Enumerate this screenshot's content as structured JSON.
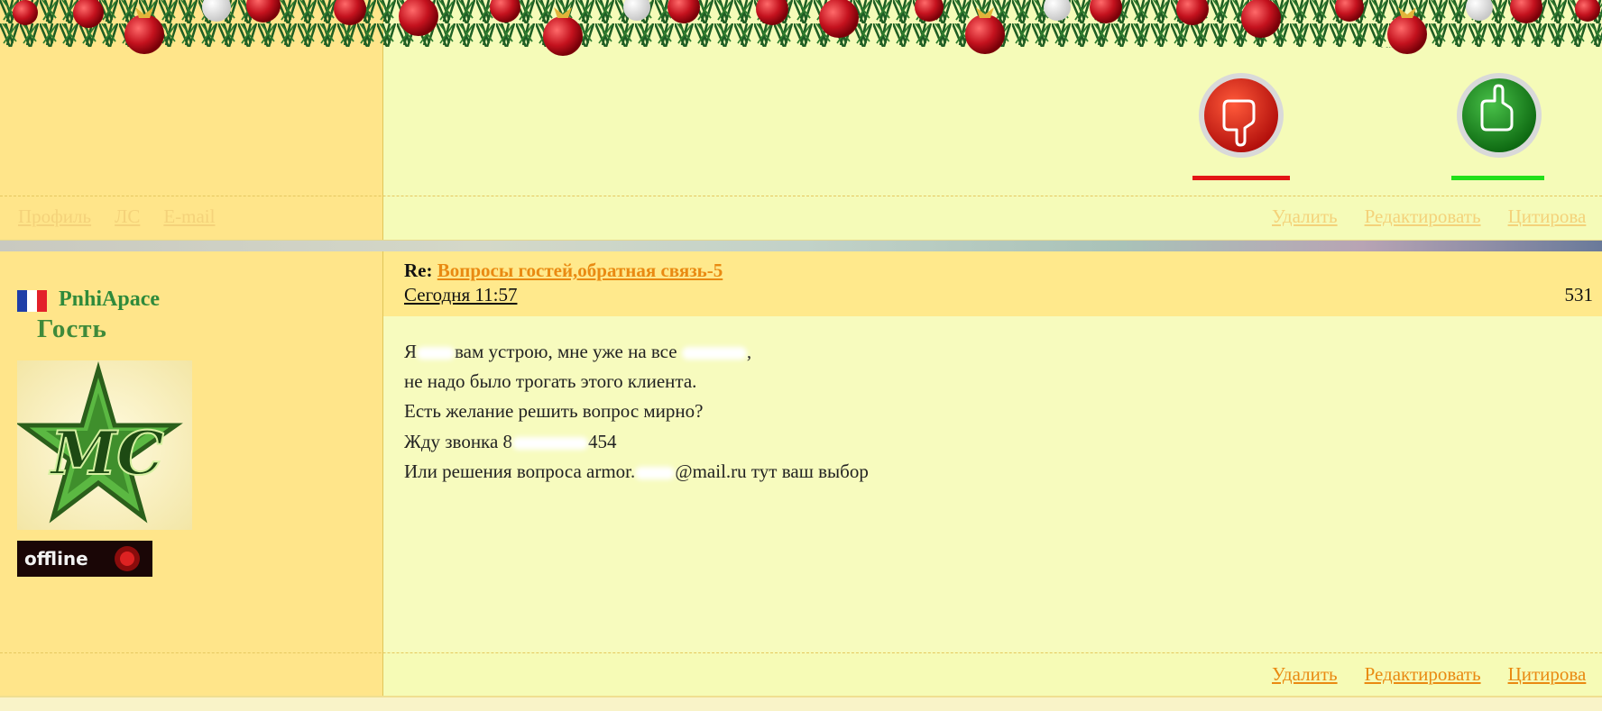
{
  "top_post": {
    "links_left": [
      "Профиль",
      "ЛС",
      "E-mail"
    ],
    "links_right": [
      "Удалить",
      "Редактировать",
      "Цитирова"
    ]
  },
  "post": {
    "author": "PnhiApace",
    "rank": "Гость",
    "status": "offline",
    "avatar_text": "MC",
    "re_prefix": "Re:",
    "topic": "Вопросы гостей,обратная связь-5",
    "date": "Сегодня 11:57",
    "number": "531",
    "lines": [
      {
        "before": "Я",
        "after": "вам устрою, мне уже на все",
        "tail": ","
      },
      {
        "text": "не надо было трогать этого клиента."
      },
      {
        "text": "Есть желание решить вопрос мирно?"
      },
      {
        "before": "Жду звонка 8",
        "after": "454"
      },
      {
        "before": "Или решения вопроса armor.",
        "after": "@mail.ru тут ваш выбор"
      }
    ],
    "actions": [
      "Удалить",
      "Редактировать",
      "Цитирова"
    ]
  },
  "colors": {
    "sidebar": "#ffe58a",
    "content": "#f6fbb6",
    "header": "#ffe98c",
    "link": "#e98a12",
    "username": "#2f8a3b",
    "dislike": "#e31515",
    "like": "#22e01a"
  }
}
